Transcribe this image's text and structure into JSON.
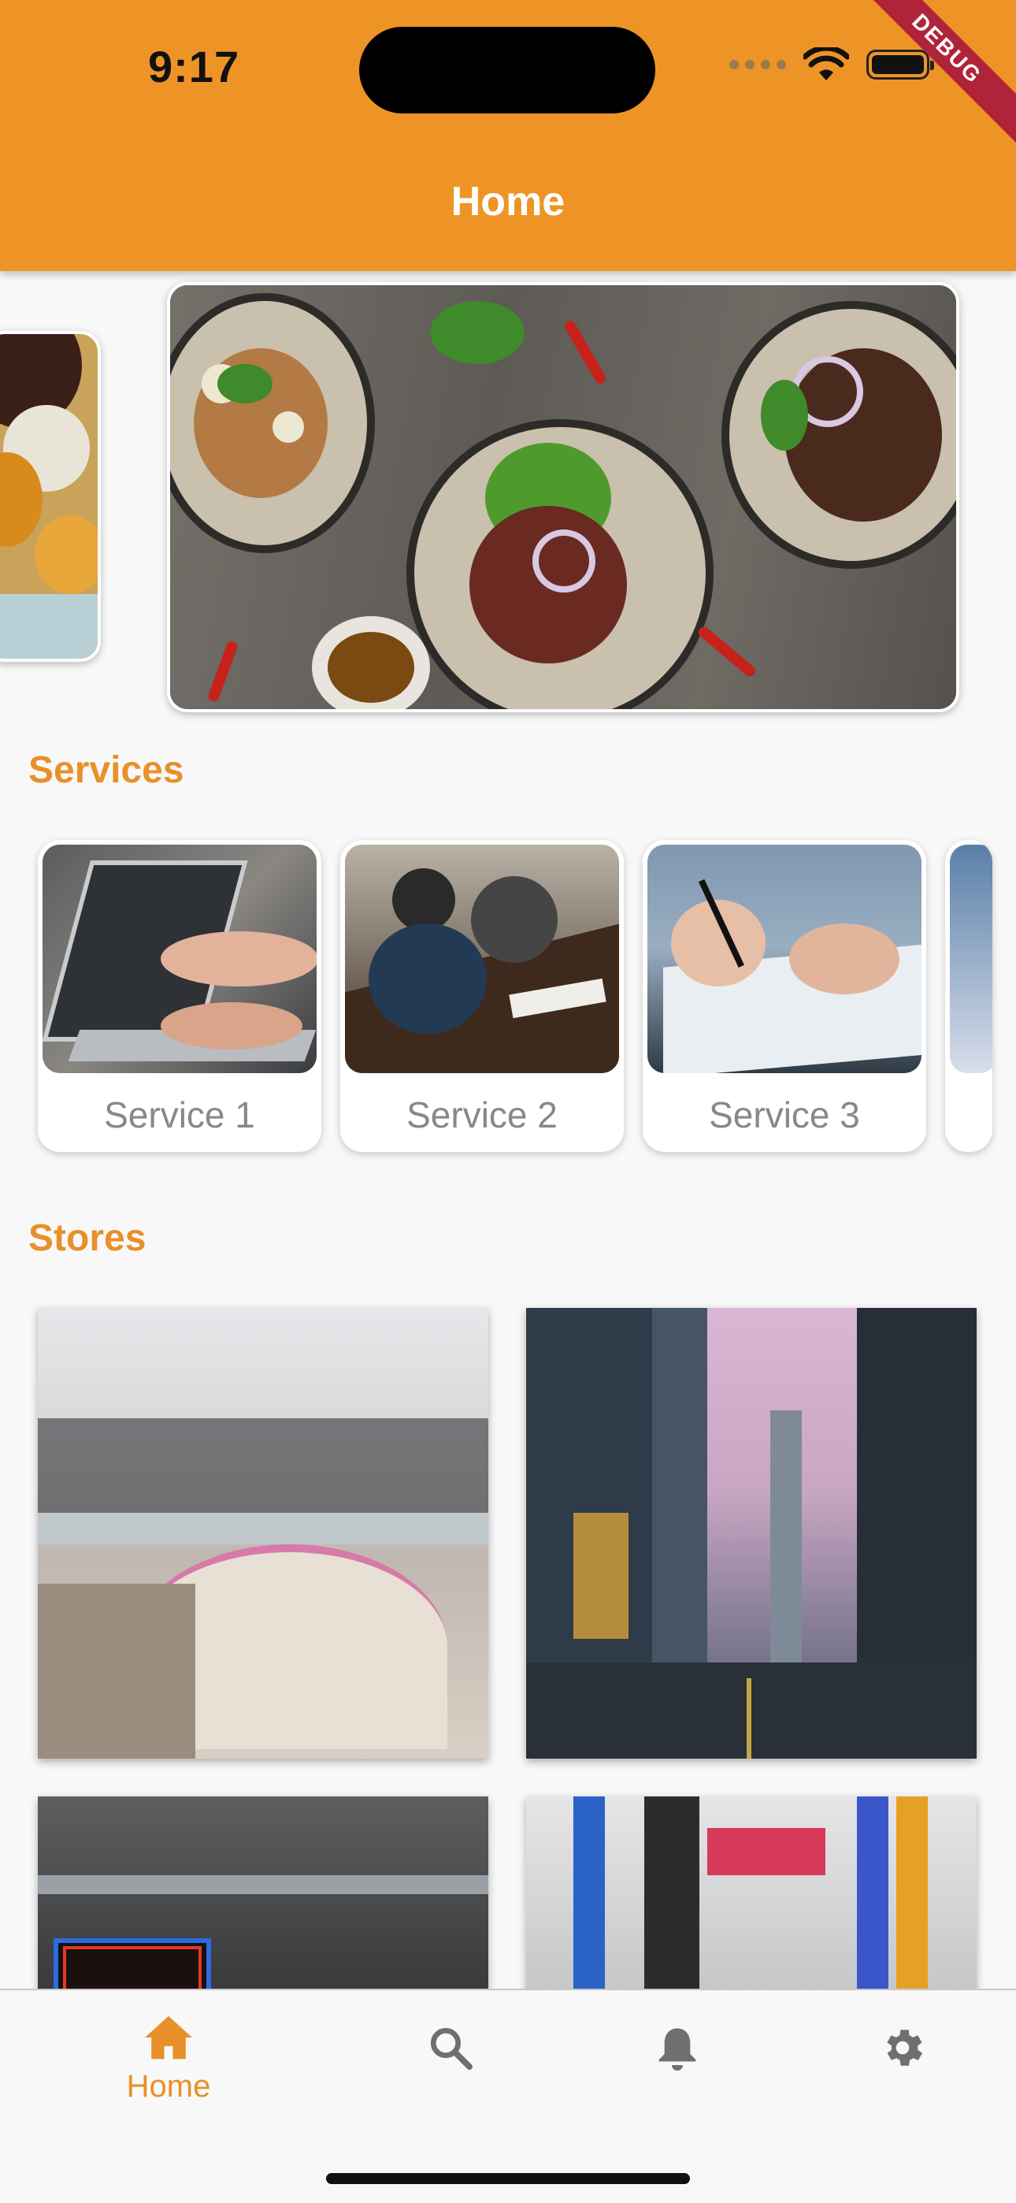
{
  "status_bar": {
    "time": "9:17"
  },
  "debug_banner": "DEBUG",
  "app_bar": {
    "title": "Home"
  },
  "sections": {
    "services_title": "Services",
    "stores_title": "Stores"
  },
  "services": [
    {
      "label": "Service 1"
    },
    {
      "label": "Service 2"
    },
    {
      "label": "Service 3"
    }
  ],
  "bottom_nav": [
    {
      "label": "Home",
      "icon": "home-icon",
      "active": true
    },
    {
      "label": "",
      "icon": "search-icon",
      "active": false
    },
    {
      "label": "",
      "icon": "bell-icon",
      "active": false
    },
    {
      "label": "",
      "icon": "gear-icon",
      "active": false
    }
  ],
  "colors": {
    "accent": "#ee9427",
    "section_title": "#e8902a",
    "inactive_icon": "#6f6f6f",
    "debug": "#b0243a"
  }
}
